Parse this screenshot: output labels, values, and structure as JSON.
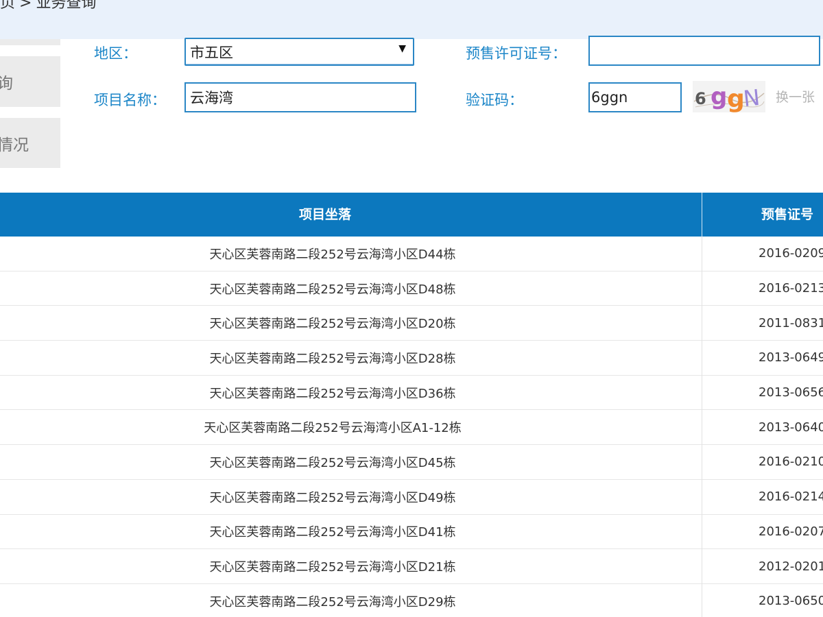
{
  "breadcrumb": {
    "prefix": "页",
    "separator": ">",
    "current": "业务查询"
  },
  "sidebar": {
    "items": [
      {
        "label": "询"
      },
      {
        "label": "情况"
      }
    ]
  },
  "form": {
    "region_label": "地区：",
    "region_value": "市五区",
    "permit_label": "预售许可证号：",
    "permit_value": "",
    "project_label": "项目名称：",
    "project_value": "云海湾",
    "captcha_label": "验证码：",
    "captcha_value": "6ggn",
    "captcha_image_text": "6gQN",
    "refresh_label": "换一张"
  },
  "table": {
    "columns": [
      "项目坐落",
      "预售证号"
    ],
    "rows": [
      {
        "address": "天心区芙蓉南路二段252号云海湾小区D44栋",
        "permit": "2016-0209"
      },
      {
        "address": "天心区芙蓉南路二段252号云海湾小区D48栋",
        "permit": "2016-0213"
      },
      {
        "address": "天心区芙蓉南路二段252号云海湾小区D20栋",
        "permit": "2011-0831"
      },
      {
        "address": "天心区芙蓉南路二段252号云海湾小区D28栋",
        "permit": "2013-0649"
      },
      {
        "address": "天心区芙蓉南路二段252号云海湾小区D36栋",
        "permit": "2013-0656"
      },
      {
        "address": "天心区芙蓉南路二段252号云海湾小区A1-12栋",
        "permit": "2013-0640"
      },
      {
        "address": "天心区芙蓉南路二段252号云海湾小区D45栋",
        "permit": "2016-0210"
      },
      {
        "address": "天心区芙蓉南路二段252号云海湾小区D49栋",
        "permit": "2016-0214"
      },
      {
        "address": "天心区芙蓉南路二段252号云海湾小区D41栋",
        "permit": "2016-0207"
      },
      {
        "address": "天心区芙蓉南路二段252号云海湾小区D21栋",
        "permit": "2012-0201"
      },
      {
        "address": "天心区芙蓉南路二段252号云海湾小区D29栋",
        "permit": "2013-0650"
      }
    ]
  },
  "colors": {
    "accent": "#1c86c8",
    "header_bg": "#0c78be",
    "topbar_bg": "#e9f1fb"
  }
}
